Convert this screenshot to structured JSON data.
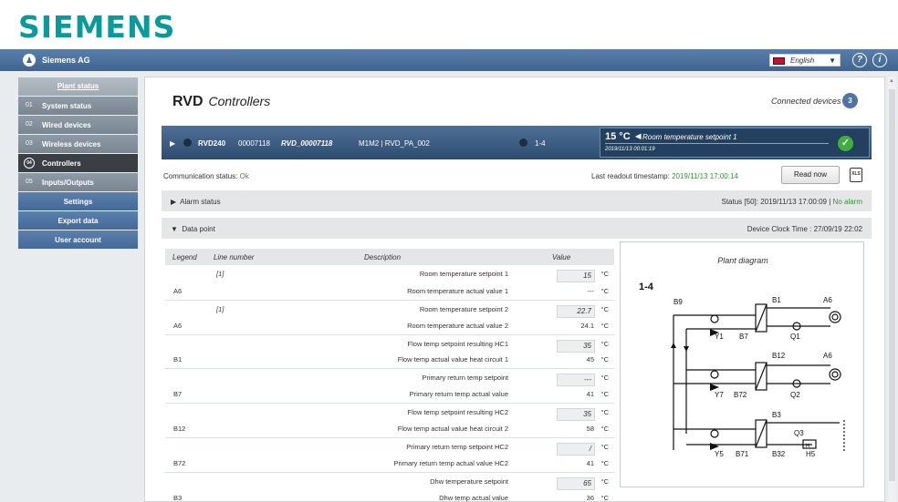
{
  "brand": {
    "logo": "SIEMENS"
  },
  "topbar": {
    "user_icon": "user-icon",
    "org_name": "Siemens AG",
    "language": "English",
    "help_icon": "?",
    "info_icon": "i"
  },
  "sidebar": {
    "items": [
      {
        "num": "",
        "label": "Plant status"
      },
      {
        "num": "01",
        "label": "System status"
      },
      {
        "num": "02",
        "label": "Wired devices"
      },
      {
        "num": "03",
        "label": "Wireless devices"
      },
      {
        "num": "04",
        "label": "Controllers"
      },
      {
        "num": "05",
        "label": "Inputs/Outputs"
      },
      {
        "num": "",
        "label": "Settings"
      },
      {
        "num": "",
        "label": "Export data"
      },
      {
        "num": "",
        "label": "User account"
      }
    ]
  },
  "header": {
    "title_bold": "RVD",
    "title_italic": "Controllers",
    "connected_label": "Connected devices",
    "connected_count": "3"
  },
  "device": {
    "model": "RVD240",
    "serial": "00007118",
    "name": "RVD_00007118",
    "type": "M1M2 | RVD_PA_002",
    "range": "1-4",
    "status_temp": "15 °C ◄",
    "status_desc": "Room temperature setpoint 1",
    "status_time": "2019/11/13 00:01:19"
  },
  "comm": {
    "label": "Communication status:",
    "value": "Ok",
    "readout_label": "Last readout timestamp:",
    "readout_value": "2019/11/13 17:00:14",
    "read_button": "Read now",
    "export_icon": "XLS"
  },
  "alarm": {
    "title": "Alarm status",
    "status_prefix": "Status [50]: 2019/11/13 17:00:09 |",
    "status_value": "No alarm"
  },
  "datapoint": {
    "title": "Data point",
    "clock": "Device Clock Time : 27/09/19 22:02"
  },
  "table": {
    "headers": {
      "legend": "Legend",
      "line": "Line number",
      "desc": "Description",
      "value": "Value"
    },
    "rows": [
      {
        "legend": "",
        "line": "[1]",
        "desc": "Room temperature setpoint 1",
        "value": "15",
        "input": true,
        "unit": "°C"
      },
      {
        "legend": "A6",
        "line": "",
        "desc": "Room temperature actual value 1",
        "value": "---",
        "input": false,
        "unit": "°C"
      },
      {
        "legend": "",
        "line": "[1]",
        "desc": "Room temperature setpoint 2",
        "value": "22.7",
        "input": true,
        "unit": "°C"
      },
      {
        "legend": "A6",
        "line": "",
        "desc": "Room temperature actual value 2",
        "value": "24.1",
        "input": false,
        "unit": "°C"
      },
      {
        "legend": "",
        "line": "",
        "desc": "Flow temp setpoint resulting HC1",
        "value": "35",
        "input": true,
        "unit": "°C"
      },
      {
        "legend": "B1",
        "line": "",
        "desc": "Flow temp actual value heat circuit 1",
        "value": "45",
        "input": false,
        "unit": "°C"
      },
      {
        "legend": "",
        "line": "",
        "desc": "Primary return temp setpoint",
        "value": "---",
        "input": true,
        "unit": "°C"
      },
      {
        "legend": "B7",
        "line": "",
        "desc": "Primary return temp actual value",
        "value": "41",
        "input": false,
        "unit": "°C"
      },
      {
        "legend": "",
        "line": "",
        "desc": "Flow temp setpoint resulting HC2",
        "value": "35",
        "input": true,
        "unit": "°C"
      },
      {
        "legend": "B12",
        "line": "",
        "desc": "Flow temp actual value heat circuit 2",
        "value": "58",
        "input": false,
        "unit": "°C"
      },
      {
        "legend": "",
        "line": "",
        "desc": "Primary return temp setpoint HC2",
        "value": "/",
        "input": true,
        "unit": "°C"
      },
      {
        "legend": "B72",
        "line": "",
        "desc": "Primary return temp actual value HC2",
        "value": "41",
        "input": false,
        "unit": "°C"
      },
      {
        "legend": "",
        "line": "",
        "desc": "Dhw temperature setpoint",
        "value": "65",
        "input": true,
        "unit": "°C"
      },
      {
        "legend": "B3",
        "line": "",
        "desc": "Dhw temp actual value",
        "value": "36",
        "input": false,
        "unit": "°C"
      }
    ]
  },
  "diagram": {
    "title": "Plant diagram",
    "range": "1-4",
    "labels": [
      "B9",
      "B1",
      "A6",
      "Y1",
      "B7",
      "Q1",
      "B12",
      "A6",
      "Y7",
      "B72",
      "Q2",
      "B3",
      "Q3",
      "Y5",
      "B71",
      "B32",
      "H5"
    ],
    "h5_box": "H"
  }
}
